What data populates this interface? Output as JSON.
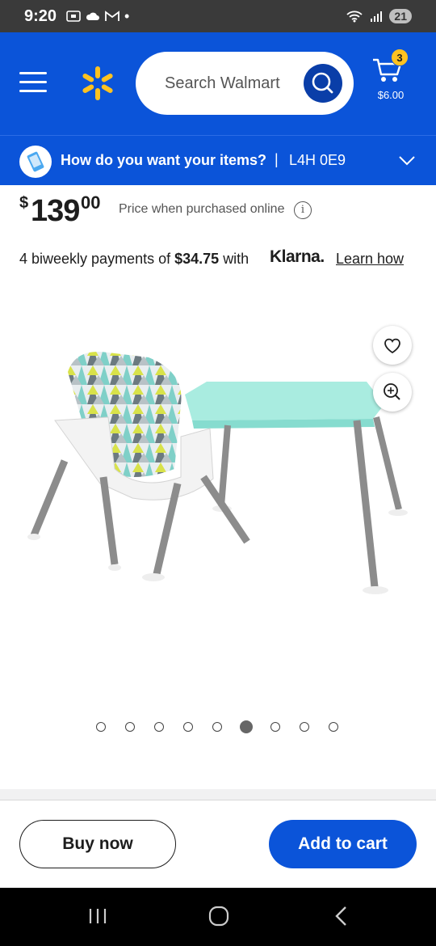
{
  "status_bar": {
    "time": "9:20",
    "battery": "21"
  },
  "header": {
    "search_placeholder": "Search Walmart",
    "cart": {
      "count": "3",
      "total": "$6.00"
    }
  },
  "delivery": {
    "question": "How do you want your items?",
    "separator": "|",
    "postal_code": "L4H 0E9"
  },
  "product": {
    "currency": "$",
    "price_whole": "139",
    "price_cents": "00",
    "price_note": "Price when purchased online",
    "klarna": {
      "prefix": "4 biweekly payments of",
      "amount": "$34.75",
      "suffix": "with",
      "brand": "Klarna.",
      "link": "Learn how"
    },
    "carousel": {
      "count": 9,
      "active_index": 5
    }
  },
  "footer": {
    "buy_now": "Buy now",
    "add_to_cart": "Add to cart"
  },
  "colors": {
    "brand_blue": "#0b54d9",
    "spark_yellow": "#ffc220",
    "search_button": "#0a3ea8"
  }
}
